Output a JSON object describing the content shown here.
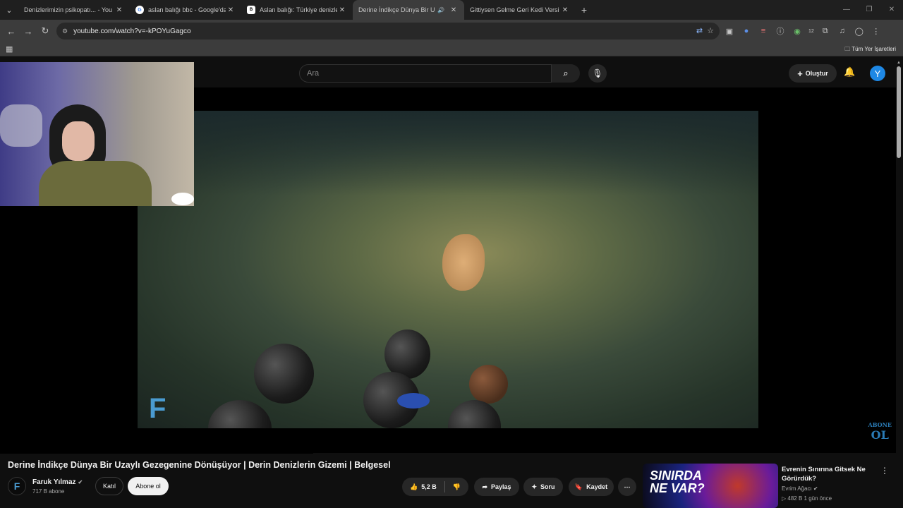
{
  "browser": {
    "tabs": [
      {
        "title": "Denizlerimizin psikopatı... - You",
        "favicon": "youtube"
      },
      {
        "title": "aslan balığı bbc - Google'da Ar",
        "favicon": "google"
      },
      {
        "title": "Aslan balığı: Türkiye denizlerind",
        "favicon": "bbc"
      },
      {
        "title": "Derine İndikçe Dünya Bir U",
        "favicon": "youtube",
        "active": true,
        "audio": true
      },
      {
        "title": "Gittiysen Gelme Geri Kedi Versi",
        "favicon": "youtube"
      }
    ],
    "url": "youtube.com/watch?v=-kPOYuGagco",
    "bookmarks_label": "Tüm Yer İşaretleri",
    "extension_badge": "12"
  },
  "youtube": {
    "search_placeholder": "Ara",
    "create_label": "Oluştur",
    "avatar_letter": "Y",
    "video": {
      "title": "Derine İndikçe Dünya Bir Uzaylı Gezegenine Dönüşüyor | Derin Denizlerin Gizemi | Belgesel",
      "channel_logo": "F",
      "watermark_line1": "ABONE",
      "watermark_line2": "OL"
    },
    "channel": {
      "name": "Faruk Yılmaz",
      "avatar_letter": "F",
      "subscribers": "717 B abone",
      "join_label": "Katıl",
      "subscribe_label": "Abone ol"
    },
    "actions": {
      "likes": "5,2 B",
      "share": "Paylaş",
      "ask": "Soru",
      "save": "Kaydet"
    },
    "related": {
      "thumb_text_line1": "SINIRDA",
      "thumb_text_line2": "NE VAR?",
      "title": "Evrenin Sınırına Gitsek Ne Görürdük?",
      "channel": "Evrim Ağacı",
      "views": "482 B",
      "age": "1 gün önce"
    }
  },
  "colors": {
    "youtube_red": "#ff0033",
    "avatar_blue": "#1e88e5",
    "channel_logo": "#4a9bd1"
  }
}
